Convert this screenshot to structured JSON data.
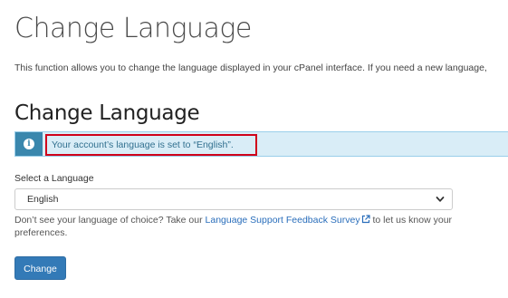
{
  "page": {
    "title": "Change Language",
    "description": "This function allows you to change the language displayed in your cPanel interface. If you need a new language,"
  },
  "section": {
    "heading": "Change Language"
  },
  "alert": {
    "icon": "info-icon",
    "message": "Your account’s language is set to “English”.",
    "highlight_color": "#d0021b"
  },
  "language_form": {
    "label": "Select a Language",
    "selected": "English",
    "help_prefix": "Don’t see your language of choice? Take our ",
    "help_link": "Language Support Feedback Survey",
    "help_suffix": " to let us know your preferences.",
    "submit_label": "Change"
  },
  "colors": {
    "button": "#337ab7",
    "alert_bg": "#d9edf7",
    "alert_icon_bg": "#3a87ad",
    "link": "#2a6ebb"
  }
}
